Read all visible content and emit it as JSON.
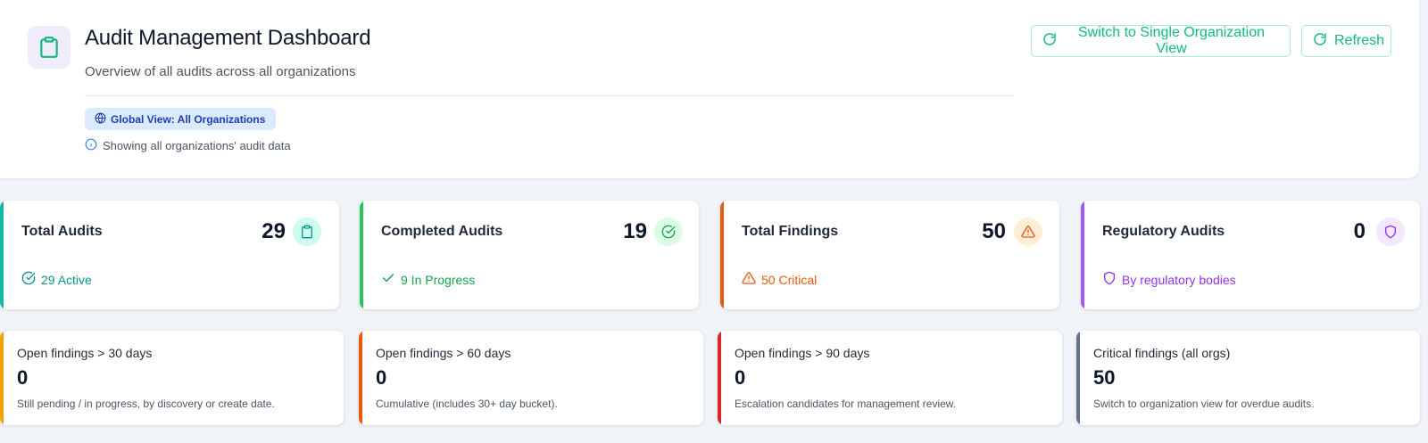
{
  "header": {
    "title": "Audit Management Dashboard",
    "subtitle": "Overview of all audits across all organizations",
    "badge_label": "Global View: All Organizations",
    "info_text": "Showing all organizations' audit data",
    "icon": "clipboard-icon"
  },
  "actions": {
    "switch_label": "Switch to Single Organization View",
    "refresh_label": "Refresh"
  },
  "colors": {
    "primary": "#10b981",
    "teal": "#14b8a6",
    "green": "#22c55e",
    "orange": "#ea580c",
    "purple": "#9333ea",
    "amber": "#f59e0b",
    "red": "#dc2626",
    "slate": "#64748b"
  },
  "stats": [
    {
      "label": "Total Audits",
      "value": "29",
      "sub": "29 Active",
      "icon": "clipboard-icon",
      "sub_icon": "check-circle-icon"
    },
    {
      "label": "Completed Audits",
      "value": "19",
      "sub": "9 In Progress",
      "icon": "check-circle-icon",
      "sub_icon": "check-icon"
    },
    {
      "label": "Total Findings",
      "value": "50",
      "sub": "50 Critical",
      "icon": "warning-triangle-icon",
      "sub_icon": "warning-triangle-icon"
    },
    {
      "label": "Regulatory Audits",
      "value": "0",
      "sub": "By regulatory bodies",
      "icon": "shield-icon",
      "sub_icon": "shield-icon"
    }
  ],
  "aging": [
    {
      "label": "Open findings > 30 days",
      "value": "0",
      "desc": "Still pending / in progress, by discovery or create date."
    },
    {
      "label": "Open findings > 60 days",
      "value": "0",
      "desc": "Cumulative (includes 30+ day bucket)."
    },
    {
      "label": "Open findings > 90 days",
      "value": "0",
      "desc": "Escalation candidates for management review."
    },
    {
      "label": "Critical findings (all orgs)",
      "value": "50",
      "desc": "Switch to organization view for overdue audits."
    }
  ]
}
